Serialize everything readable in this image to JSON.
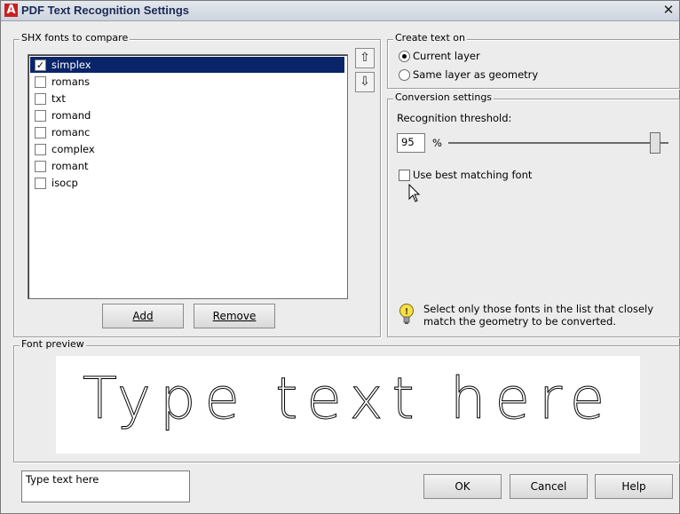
{
  "window": {
    "title": "PDF Text Recognition Settings",
    "app_icon_letter": "A",
    "close_glyph": "✕"
  },
  "shx_fonts": {
    "legend": "SHX fonts to compare",
    "items": [
      {
        "label": "simplex",
        "checked": true,
        "selected": true
      },
      {
        "label": "romans",
        "checked": false
      },
      {
        "label": "txt",
        "checked": false
      },
      {
        "label": "romand",
        "checked": false
      },
      {
        "label": "romanc",
        "checked": false
      },
      {
        "label": "complex",
        "checked": false
      },
      {
        "label": "romant",
        "checked": false
      },
      {
        "label": "isocp",
        "checked": false
      }
    ],
    "move_up_glyph": "⇧",
    "move_down_glyph": "⇩",
    "add_label": "Add",
    "remove_label": "Remove"
  },
  "create_text_on": {
    "legend": "Create text on",
    "options": [
      "Current layer",
      "Same layer as geometry"
    ],
    "selected_index": 0
  },
  "conversion": {
    "legend": "Conversion settings",
    "threshold_label": "Recognition threshold:",
    "threshold_value": "95",
    "threshold_unit": "%",
    "threshold_fraction": 0.95,
    "use_best_label": "Use best matching font",
    "use_best_checked": false,
    "hint": "Select only those fonts in the list that closely match the geometry to be converted."
  },
  "preview": {
    "legend": "Font preview",
    "text": "Type text here"
  },
  "footer": {
    "input_value": "Type text here",
    "ok_label": "OK",
    "cancel_label": "Cancel",
    "help_label": "Help"
  },
  "colors": {
    "accent": "#0a246a",
    "app_icon": "#c8201f"
  }
}
